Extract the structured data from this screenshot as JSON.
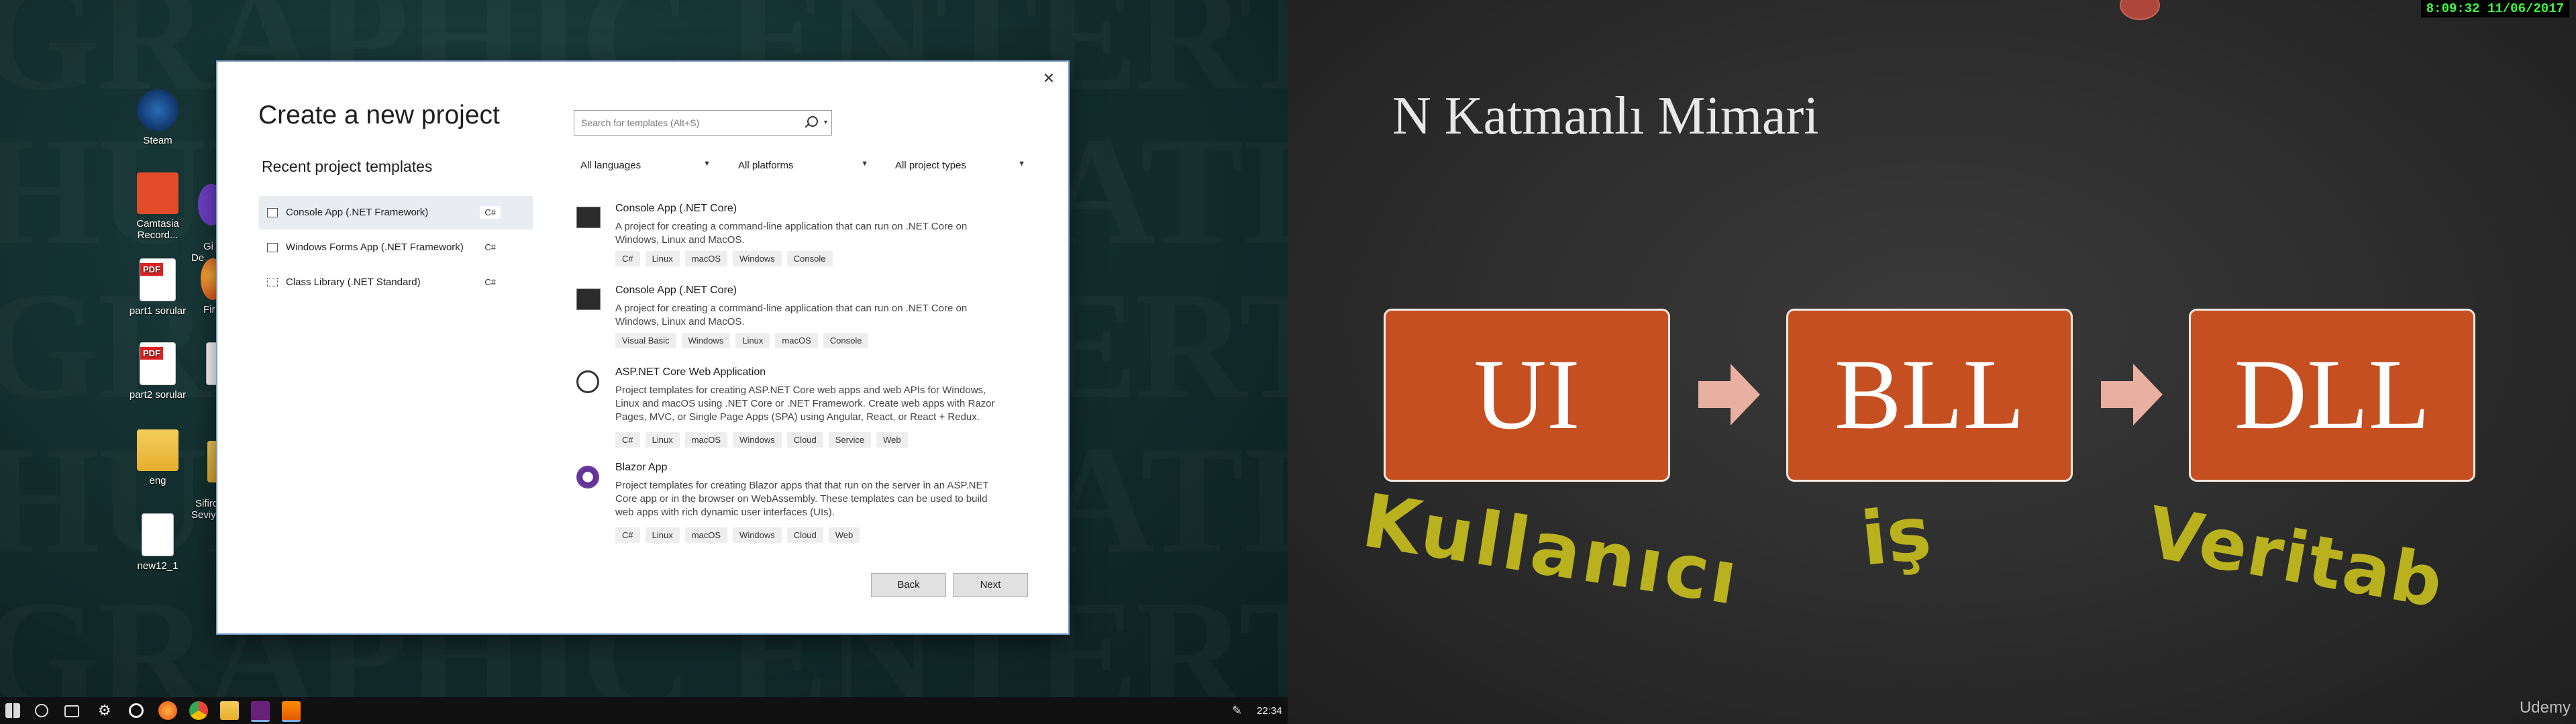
{
  "desktop": {
    "watermark": "GRAPHIC ENTERTAINMENT\nHUMAN ASPIRATION\nGRAPHIC ENTERTAINMENT\nHUMAN ASPIRATION\nGRAPHIC ENTERTAINMENT",
    "icons": [
      {
        "label": "Steam",
        "icon": "steam-icon"
      },
      {
        "label": "Camtasia Record...",
        "icon": "camtasia-icon"
      },
      {
        "label": "part1 sorular",
        "icon": "pdf-icon"
      },
      {
        "label": "part2 sorular",
        "icon": "pdf-icon"
      },
      {
        "label": "eng",
        "icon": "folder-icon"
      },
      {
        "label": "new12_1",
        "icon": "file-icon"
      },
      {
        "label": "Gi\nDe",
        "icon": "github-desktop-icon"
      },
      {
        "label": "Fir",
        "icon": "firefox-icon"
      },
      {
        "label": "Sifird\nSeviy",
        "icon": "folder-icon"
      }
    ]
  },
  "taskbar": {
    "time": "22:34",
    "items": [
      "start-icon",
      "search-icon",
      "task-view-icon",
      "settings-icon",
      "obs-icon",
      "firefox-icon",
      "chrome-icon",
      "file-explorer-icon",
      "visual-studio-icon",
      "vlc-icon"
    ],
    "active_color": "#7fb0e6"
  },
  "dialog": {
    "title": "Create a new project",
    "recent_heading": "Recent project templates",
    "close_glyph": "✕",
    "recent": [
      {
        "name": "Console App (.NET Framework)",
        "lang": "C#",
        "selected": true
      },
      {
        "name": "Windows Forms App (.NET Framework)",
        "lang": "C#",
        "selected": false
      },
      {
        "name": "Class Library (.NET Standard)",
        "lang": "C#",
        "selected": false
      }
    ],
    "search_placeholder": "Search for templates (Alt+S)",
    "filters": [
      {
        "label": "All languages"
      },
      {
        "label": "All platforms"
      },
      {
        "label": "All project types"
      }
    ],
    "templates": [
      {
        "name": "Console App (.NET Core)",
        "desc": "A project for creating a command-line application that can run on .NET Core on Windows, Linux and MacOS.",
        "tags": [
          "C#",
          "Linux",
          "macOS",
          "Windows",
          "Console"
        ],
        "icon": "console-app-icon"
      },
      {
        "name": "Console App (.NET Core)",
        "desc": "A project for creating a command-line application that can run on .NET Core on Windows, Linux and MacOS.",
        "tags": [
          "Visual Basic",
          "Windows",
          "Linux",
          "macOS",
          "Console"
        ],
        "icon": "console-app-icon"
      },
      {
        "name": "ASP.NET Core Web Application",
        "desc": "Project templates for creating ASP.NET Core web apps and web APIs for Windows, Linux and macOS using .NET Core or .NET Framework. Create web apps with Razor Pages, MVC, or Single Page Apps (SPA) using Angular, React, or React + Redux.",
        "tags": [
          "C#",
          "Linux",
          "macOS",
          "Windows",
          "Cloud",
          "Service",
          "Web"
        ],
        "icon": "web-globe-icon"
      },
      {
        "name": "Blazor App",
        "desc": "Project templates for creating Blazor apps that that run on the server in an ASP.NET Core app or in the browser on WebAssembly. These templates can be used to build web apps with rich dynamic user interfaces (UIs).",
        "tags": [
          "C#",
          "Linux",
          "macOS",
          "Windows",
          "Cloud",
          "Web"
        ],
        "icon": "blazor-icon"
      }
    ],
    "back_label": "Back",
    "next_label": "Next"
  },
  "slide": {
    "title": "N Katmanlı Mimari",
    "clock": "8:09:32  11/06/2017",
    "boxes": [
      "UI",
      "BLL",
      "DLL"
    ],
    "box_color": "#c54f20",
    "arrow_color": "#e9b0a2",
    "handwriting": [
      "Kullanıcı",
      "iş",
      "Veritab"
    ],
    "handwriting_color": "#b9b21e",
    "brand": "Udemy"
  }
}
